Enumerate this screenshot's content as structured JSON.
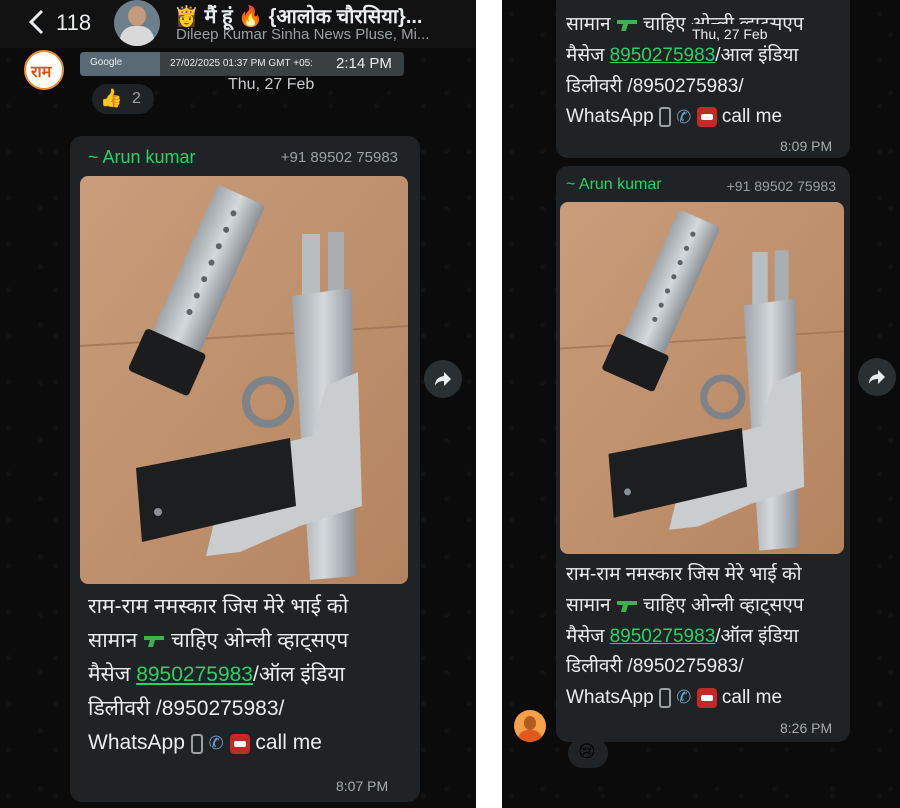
{
  "header": {
    "back_count": "118",
    "group_name": "👸 मैं हूं 🔥 {आलोक चौरसिया}...",
    "members": "Dileep Kumar Sinha News Pluse, Mi..."
  },
  "top_strip": {
    "google": "Google",
    "timestamp": "27/02/2025 01:37 PM GMT +05:",
    "time": "2:14 PM",
    "reaction_count": "2"
  },
  "left_panel": {
    "date_chip": "Thu, 27 Feb",
    "message": {
      "sender": "~ Arun kumar",
      "phone": "+91 89502 75983",
      "line1": "राम-राम नमस्कार जिस मेरे भाई को",
      "line2_pre": "सामान",
      "line2_post": "चाहिए ओन्ली व्हाट्सएप",
      "line3_pre": "मैसेज",
      "phone_link": "8950275983",
      "line3_post": "/ऑल इंडिया",
      "line4": "डिलीवरी /8950275983/",
      "line5_pre": "WhatsApp",
      "line5_post": "call me",
      "time": "8:07 PM"
    }
  },
  "right_panel": {
    "date_chip": "Thu, 27 Feb",
    "prev_message": {
      "line1_pre": "सामान",
      "line1_post": "चाहिए ओन्ली व्हाट्सएप",
      "line2_pre": "मैसेज",
      "phone_link": "8950275983",
      "line2_post": "/आल इंडिया",
      "line3": "डिलीवरी /8950275983/",
      "line4_pre": "WhatsApp",
      "line4_post": "call me",
      "time": "8:09 PM"
    },
    "message": {
      "sender": "~ Arun kumar",
      "phone": "+91 89502 75983",
      "line1": "राम-राम नमस्कार जिस मेरे भाई को",
      "line2_pre": "सामान",
      "line2_post": "चाहिए ओन्ली व्हाट्सएप",
      "line3_pre": "मैसेज",
      "phone_link": "8950275983",
      "line3_post": "/ऑल इंडिया",
      "line4": "डिलीवरी /8950275983/",
      "line5_pre": "WhatsApp",
      "line5_post": "call me",
      "time": "8:26 PM"
    }
  },
  "colors": {
    "background": "#0b0b0b",
    "bubble": "#1f2326",
    "sender_green": "#25d366",
    "text": "#e9edef",
    "meta": "#a6abad"
  }
}
